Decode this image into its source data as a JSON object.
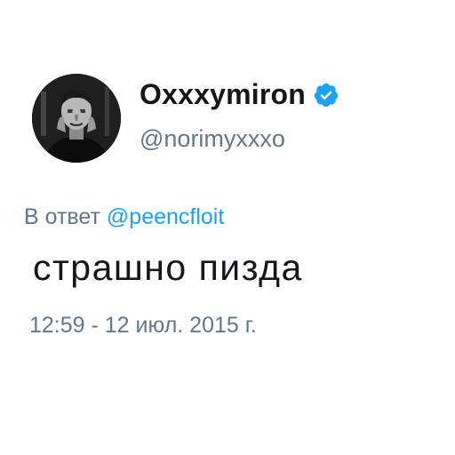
{
  "author": {
    "display_name": "Oxxxymiron",
    "handle": "@norimyxxxo",
    "verified": true,
    "avatar_icon": "portrait-avatar"
  },
  "reply": {
    "prefix": "В ответ",
    "handle": "@peencfloit"
  },
  "tweet": {
    "text": "страшно пизда",
    "timestamp": "12:59 - 12 июл. 2015 г."
  },
  "colors": {
    "link": "#1da1f2",
    "secondary_text": "#657786",
    "primary_text": "#14171a",
    "verified_badge": "#1da1f2"
  }
}
